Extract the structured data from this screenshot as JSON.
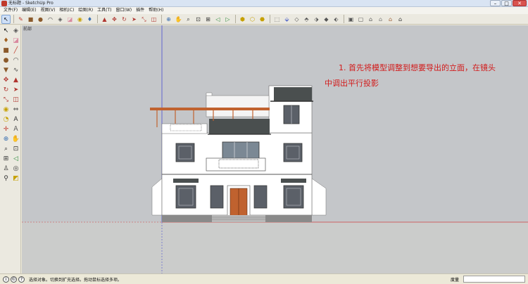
{
  "window": {
    "title": "无标题 - SketchUp Pro",
    "controls": [
      "–",
      "□",
      "✕"
    ]
  },
  "menu": [
    "文件(F)",
    "编辑(E)",
    "视图(V)",
    "相机(C)",
    "绘图(R)",
    "工具(T)",
    "窗口(W)",
    "插件",
    "帮助(H)"
  ],
  "toolbar": {
    "icons": [
      {
        "name": "select-icon",
        "glyph": "↖",
        "selected": true
      },
      {
        "name": "pencil-icon",
        "glyph": "✎",
        "color": "#c0392b"
      },
      {
        "name": "rectangle-icon",
        "glyph": "■",
        "color": "#8b5a2b"
      },
      {
        "name": "circle-icon",
        "glyph": "●",
        "color": "#8b5a2b"
      },
      {
        "name": "arc-icon",
        "glyph": "◠",
        "color": "#444"
      },
      {
        "name": "make-component-icon",
        "glyph": "◈",
        "color": "#555"
      },
      {
        "name": "eraser-icon",
        "glyph": "◪",
        "color": "#d98aa0"
      },
      {
        "name": "tape-measure-icon",
        "glyph": "◉",
        "color": "#c6a000"
      },
      {
        "name": "paint-bucket-icon",
        "glyph": "♦",
        "color": "#3a6fb0"
      },
      {
        "name": "push-pull-icon",
        "glyph": "▲",
        "color": "#b0352f"
      },
      {
        "name": "move-icon",
        "glyph": "✥",
        "color": "#b0352f"
      },
      {
        "name": "rotate-icon",
        "glyph": "↻",
        "color": "#b0352f"
      },
      {
        "name": "follow-me-icon",
        "glyph": "➤",
        "color": "#b0352f"
      },
      {
        "name": "scale-icon",
        "glyph": "⤡",
        "color": "#b0352f"
      },
      {
        "name": "offset-icon",
        "glyph": "◫",
        "color": "#b0352f"
      },
      {
        "name": "orbit-icon",
        "glyph": "⊕",
        "color": "#3a6fb0"
      },
      {
        "name": "pan-icon",
        "glyph": "✋",
        "color": "#333"
      },
      {
        "name": "zoom-icon",
        "glyph": "⌕",
        "color": "#333"
      },
      {
        "name": "zoom-window-icon",
        "glyph": "⊡",
        "color": "#333"
      },
      {
        "name": "zoom-extents-icon",
        "glyph": "⊞",
        "color": "#333"
      },
      {
        "name": "previous-view-icon",
        "glyph": "◁",
        "color": "#2a8a3a"
      },
      {
        "name": "next-view-icon",
        "glyph": "▷",
        "color": "#2a8a3a"
      },
      {
        "name": "get-models-icon",
        "glyph": "⬢",
        "color": "#c6a000"
      },
      {
        "name": "share-model-icon",
        "glyph": "⬡",
        "color": "#c6a000"
      },
      {
        "name": "share-component-icon",
        "glyph": "⬣",
        "color": "#c6a000"
      },
      {
        "name": "extension-warehouse-icon",
        "glyph": "⬚",
        "color": "#666"
      },
      {
        "name": "iso-view-icon",
        "glyph": "⬙",
        "color": "#6677cc"
      },
      {
        "name": "top-view-icon",
        "glyph": "◇",
        "color": "#555"
      },
      {
        "name": "front-view-icon",
        "glyph": "⬘",
        "color": "#555"
      },
      {
        "name": "right-view-icon",
        "glyph": "⬗",
        "color": "#555"
      },
      {
        "name": "back-view-icon",
        "glyph": "◆",
        "color": "#555"
      },
      {
        "name": "left-view-icon",
        "glyph": "⬖",
        "color": "#555"
      },
      {
        "name": "xray-icon",
        "glyph": "▣",
        "color": "#555"
      },
      {
        "name": "wireframe-icon",
        "glyph": "▢",
        "color": "#555"
      },
      {
        "name": "hidden-line-icon",
        "glyph": "⌂",
        "color": "#555"
      },
      {
        "name": "shaded-icon",
        "glyph": "⌂",
        "color": "#777"
      },
      {
        "name": "shaded-textures-icon",
        "glyph": "⌂",
        "color": "#a0623a"
      },
      {
        "name": "monochrome-icon",
        "glyph": "⌂",
        "color": "#333"
      }
    ]
  },
  "palette": [
    {
      "name": "select-tool-icon",
      "glyph": "↖",
      "color": "#000"
    },
    {
      "name": "make-component-tool-icon",
      "glyph": "◈",
      "color": "#555"
    },
    {
      "name": "paint-bucket-tool-icon",
      "glyph": "♦",
      "color": "#a06020"
    },
    {
      "name": "eraser-tool-icon",
      "glyph": "◪",
      "color": "#d98aa0"
    },
    {
      "name": "rectangle-tool-icon",
      "glyph": "■",
      "color": "#8b5a2b"
    },
    {
      "name": "line-tool-icon",
      "glyph": "╱",
      "color": "#c0392b"
    },
    {
      "name": "circle-tool-icon",
      "glyph": "●",
      "color": "#8b5a2b"
    },
    {
      "name": "arc-tool-icon",
      "glyph": "◠",
      "color": "#444"
    },
    {
      "name": "polygon-tool-icon",
      "glyph": "▼",
      "color": "#8b5a2b"
    },
    {
      "name": "freehand-tool-icon",
      "glyph": "∿",
      "color": "#444"
    },
    {
      "name": "move-tool-icon",
      "glyph": "✥",
      "color": "#b0352f"
    },
    {
      "name": "push-pull-tool-icon",
      "glyph": "▲",
      "color": "#b0352f"
    },
    {
      "name": "rotate-tool-icon",
      "glyph": "↻",
      "color": "#b0352f"
    },
    {
      "name": "follow-me-tool-icon",
      "glyph": "➤",
      "color": "#b0352f"
    },
    {
      "name": "scale-tool-icon",
      "glyph": "⤡",
      "color": "#b0352f"
    },
    {
      "name": "offset-tool-icon",
      "glyph": "◫",
      "color": "#b0352f"
    },
    {
      "name": "tape-measure-tool-icon",
      "glyph": "◉",
      "color": "#c6a000"
    },
    {
      "name": "dimension-tool-icon",
      "glyph": "⇔",
      "color": "#444"
    },
    {
      "name": "protractor-tool-icon",
      "glyph": "◔",
      "color": "#c6a000"
    },
    {
      "name": "text-tool-icon",
      "glyph": "A",
      "color": "#333"
    },
    {
      "name": "axes-tool-icon",
      "glyph": "✛",
      "color": "#c0392b"
    },
    {
      "name": "3d-text-tool-icon",
      "glyph": "Ａ",
      "color": "#555"
    },
    {
      "name": "orbit-tool-icon",
      "glyph": "⊕",
      "color": "#3a6fb0"
    },
    {
      "name": "pan-tool-icon",
      "glyph": "✋",
      "color": "#333"
    },
    {
      "name": "zoom-tool-icon",
      "glyph": "⌕",
      "color": "#333"
    },
    {
      "name": "zoom-window-tool-icon",
      "glyph": "⊡",
      "color": "#333"
    },
    {
      "name": "zoom-extents-tool-icon",
      "glyph": "⊞",
      "color": "#333"
    },
    {
      "name": "previous-tool-icon",
      "glyph": "◁",
      "color": "#2a8a3a"
    },
    {
      "name": "position-camera-tool-icon",
      "glyph": "♙",
      "color": "#333"
    },
    {
      "name": "look-around-tool-icon",
      "glyph": "◎",
      "color": "#333"
    },
    {
      "name": "walk-tool-icon",
      "glyph": "⚲",
      "color": "#333"
    },
    {
      "name": "section-plane-tool-icon",
      "glyph": "◩",
      "color": "#c6a000"
    }
  ],
  "viewport": {
    "scene_label": "前部",
    "annotation": {
      "line1": "1. 首先将模型调整到想要导出的立面，在镜头",
      "line2": "中调出平行投影"
    },
    "colors": {
      "sky": "#c4c6c9",
      "ground": "#cbcccb",
      "wall": "#ffffff",
      "roof_tile": "#4a4f4f",
      "door": "#c0622f",
      "pergola": "#c0622f",
      "base_stone": "#8a8a8a",
      "annotation": "#d21a1a"
    }
  },
  "statusbar": {
    "icons": [
      "i",
      "©",
      "?"
    ],
    "text": "选择对象。切换到扩充选择。拖动鼠标选择多项。",
    "measure_label": "度量",
    "measure_value": ""
  }
}
